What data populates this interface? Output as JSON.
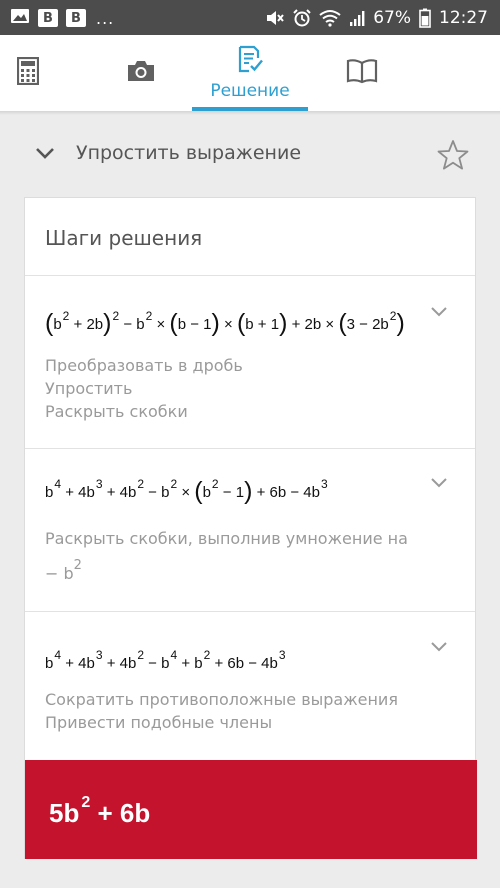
{
  "status_bar": {
    "notif1": "B",
    "notif2": "B",
    "more": "...",
    "battery": "67%",
    "time": "12:27"
  },
  "tabs": {
    "solution_label": "Решение",
    "accent_color": "#2e9fd1",
    "icons": [
      "calculator-icon",
      "camera-icon",
      "solution-icon",
      "book-icon"
    ]
  },
  "header": {
    "title": "Упростить выражение"
  },
  "card": {
    "title": "Шаги решения",
    "steps": [
      {
        "expr": {
          "b": "b",
          "e2": "2",
          "plus2b": "+ 2b",
          "outer_exp": "2",
          "minus_b": "− b",
          "e2b": "2",
          "times1": "×",
          "bm1": "b − 1",
          "times2": "×",
          "bp1": "b + 1",
          "plus_2b": "+ 2b",
          "times3": "×",
          "three_minus": "3 − 2b",
          "e2c": "2"
        },
        "lines": [
          "Преобразовать в дробь",
          "Упростить",
          "Раскрыть скобки"
        ]
      },
      {
        "expr": {
          "b4": "b",
          "e4": "4",
          "p4b": "+ 4b",
          "e3": "3",
          "p4b2": "+ 4b",
          "e2": "2",
          "mb": "− b",
          "e2b": "2",
          "times": "×",
          "b2": "b",
          "e2c": "2",
          "m1": "− 1",
          "p6b": "+ 6b",
          "m4b": "− 4b",
          "e3b": "3"
        },
        "lines": [
          "Раскрыть скобки, выполнив умножение на"
        ],
        "tail": "− b",
        "tail_exp": "2"
      },
      {
        "expr": {
          "b4": "b",
          "e4": "4",
          "p4b": "+ 4b",
          "e3": "3",
          "p4b2": "+ 4b",
          "e2": "2",
          "mb4": "− b",
          "e4b": "4",
          "pb": "+ b",
          "e2b": "2",
          "p6b": "+ 6b",
          "m4b": "− 4b",
          "e3b": "3"
        },
        "lines": [
          "Сократить противоположные выражения",
          "Привести подобные члены"
        ]
      }
    ],
    "answer": {
      "b_part": "5b",
      "exp": "2",
      "rest": "+ 6b",
      "bg_color": "#c4132c"
    }
  }
}
